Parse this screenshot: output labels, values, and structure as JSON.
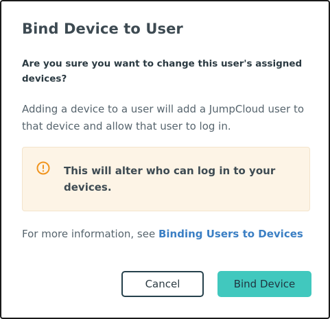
{
  "dialog": {
    "title": "Bind Device to User",
    "question": "Are you sure you want to change this user's assigned devices?",
    "description": "Adding a device to a user will add a JumpCloud user to that device and allow that user to log in.",
    "warning": {
      "icon": "warning-circle-icon",
      "text": "This will alter who can log in to your devices."
    },
    "more_info": {
      "prefix": "For more information, see ",
      "link_text": "Binding Users to Devices"
    },
    "buttons": {
      "cancel": "Cancel",
      "confirm": "Bind Device"
    }
  },
  "colors": {
    "primary": "#41c8be",
    "link": "#3b7fc4",
    "warning_bg": "#fdf4e6",
    "warning_icon": "#f0941e"
  }
}
